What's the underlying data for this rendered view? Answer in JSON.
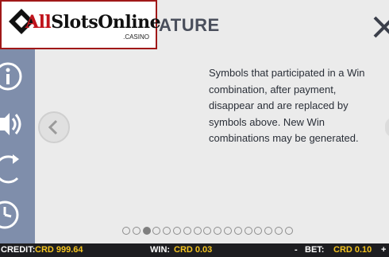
{
  "logo": {
    "text_part1": "All",
    "text_part2": "Slots",
    "text_part3": "Online",
    "sub": ".CASINO"
  },
  "page": {
    "title": "ATURE",
    "body": "Symbols that participated in a Win combination, after payment, disappear and are replaced by symbols above. New Win combinations may be generated."
  },
  "sidebar": {
    "items": [
      "info-icon",
      "sound-icon",
      "refresh-icon",
      "history-icon"
    ]
  },
  "pagination": {
    "total": 17,
    "active_index": 2
  },
  "footer": {
    "credit_label": "CREDIT:",
    "credit_value": "CRD 999.64",
    "win_label": "WIN:",
    "win_value": "CRD 0.03",
    "minus": "-",
    "bet_label": "BET:",
    "bet_value": "CRD 0.10",
    "plus": "+"
  },
  "colors": {
    "sidebar": "#7f8eab",
    "accent_yellow": "#f5c41e",
    "logo_red": "#c0141c"
  }
}
